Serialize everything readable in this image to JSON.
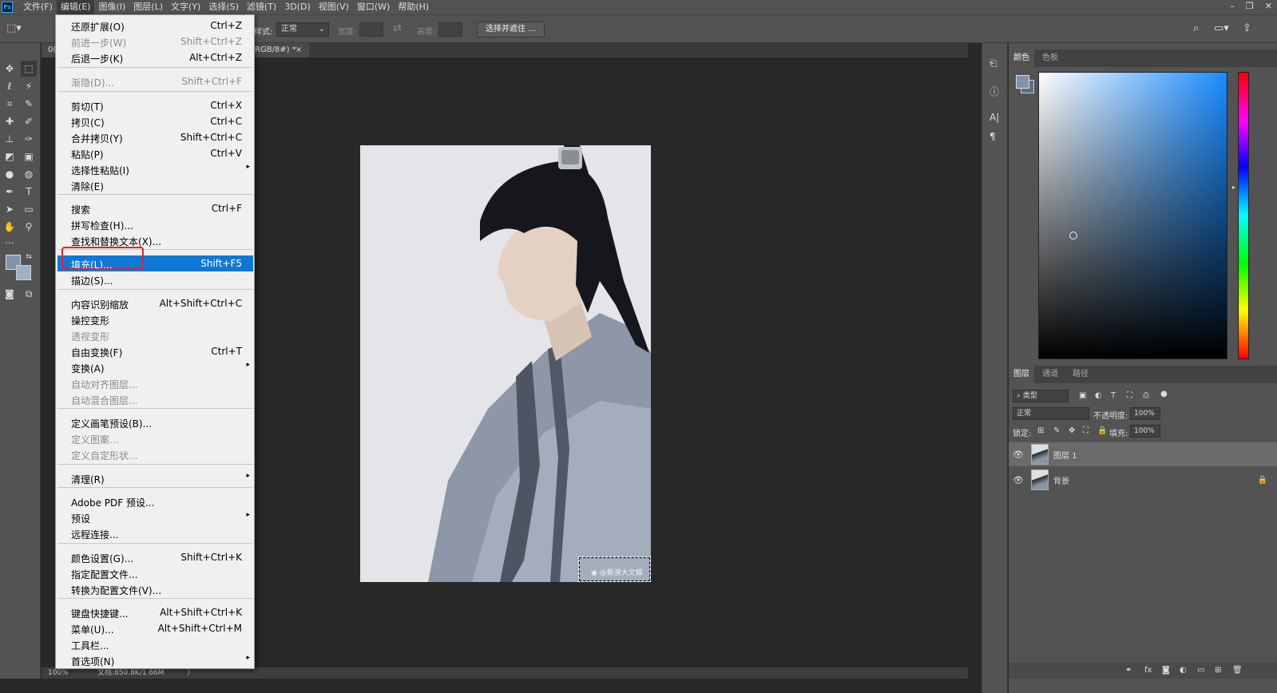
{
  "menubar": {
    "logo": "Ps",
    "items": [
      "文件(F)",
      "编辑(E)",
      "图像(I)",
      "图层(L)",
      "文字(Y)",
      "选择(S)",
      "滤镜(T)",
      "3D(D)",
      "视图(V)",
      "窗口(W)",
      "帮助(H)"
    ],
    "window_controls": [
      "–",
      "❐",
      "✕"
    ]
  },
  "options": {
    "style_label": "样式:",
    "style_value": "正常",
    "width_label": "宽度:",
    "height_label": "高度:",
    "select_mask_button": "选择并遮住 ..."
  },
  "document": {
    "tab_title": "RGB/8#) *",
    "tab_prefix": "0(",
    "watermark": "@新浪大文娱"
  },
  "status": {
    "zoom": "100%",
    "doc_info": "文档:850.8K/1.66M",
    "arrow": "〉"
  },
  "edit_menu": [
    {
      "label": "还原扩展(O)",
      "shortcut": "Ctrl+Z",
      "disabled": false
    },
    {
      "label": "前进一步(W)",
      "shortcut": "Shift+Ctrl+Z",
      "disabled": true
    },
    {
      "label": "后退一步(K)",
      "shortcut": "Alt+Ctrl+Z",
      "disabled": false
    },
    {
      "label": "渐隐(D)...",
      "shortcut": "Shift+Ctrl+F",
      "disabled": true
    },
    {
      "label": "剪切(T)",
      "shortcut": "Ctrl+X",
      "disabled": false
    },
    {
      "label": "拷贝(C)",
      "shortcut": "Ctrl+C",
      "disabled": false
    },
    {
      "label": "合并拷贝(Y)",
      "shortcut": "Shift+Ctrl+C",
      "disabled": false
    },
    {
      "label": "粘贴(P)",
      "shortcut": "Ctrl+V",
      "disabled": false
    },
    {
      "label": "选择性粘贴(I)",
      "shortcut": "",
      "disabled": false,
      "submenu": true
    },
    {
      "label": "清除(E)",
      "shortcut": "",
      "disabled": false
    },
    {
      "label": "搜索",
      "shortcut": "Ctrl+F",
      "disabled": false
    },
    {
      "label": "拼写检查(H)...",
      "shortcut": "",
      "disabled": false
    },
    {
      "label": "查找和替换文本(X)...",
      "shortcut": "",
      "disabled": false
    },
    {
      "label": "填充(L)...",
      "shortcut": "Shift+F5",
      "disabled": false,
      "highlighted": true
    },
    {
      "label": "描边(S)...",
      "shortcut": "",
      "disabled": false
    },
    {
      "label": "内容识别缩放",
      "shortcut": "Alt+Shift+Ctrl+C",
      "disabled": false
    },
    {
      "label": "操控变形",
      "shortcut": "",
      "disabled": false
    },
    {
      "label": "透视变形",
      "shortcut": "",
      "disabled": true
    },
    {
      "label": "自由变换(F)",
      "shortcut": "Ctrl+T",
      "disabled": false
    },
    {
      "label": "变换(A)",
      "shortcut": "",
      "disabled": false,
      "submenu": true
    },
    {
      "label": "自动对齐图层...",
      "shortcut": "",
      "disabled": true
    },
    {
      "label": "自动混合图层...",
      "shortcut": "",
      "disabled": true
    },
    {
      "label": "定义画笔预设(B)...",
      "shortcut": "",
      "disabled": false
    },
    {
      "label": "定义图案...",
      "shortcut": "",
      "disabled": true
    },
    {
      "label": "定义自定形状...",
      "shortcut": "",
      "disabled": true
    },
    {
      "label": "清理(R)",
      "shortcut": "",
      "disabled": false,
      "submenu": true
    },
    {
      "label": "Adobe PDF 预设...",
      "shortcut": "",
      "disabled": false
    },
    {
      "label": "预设",
      "shortcut": "",
      "disabled": false,
      "submenu": true
    },
    {
      "label": "远程连接...",
      "shortcut": "",
      "disabled": false
    },
    {
      "label": "颜色设置(G)...",
      "shortcut": "Shift+Ctrl+K",
      "disabled": false
    },
    {
      "label": "指定配置文件...",
      "shortcut": "",
      "disabled": false
    },
    {
      "label": "转换为配置文件(V)...",
      "shortcut": "",
      "disabled": false
    },
    {
      "label": "键盘快捷键...",
      "shortcut": "Alt+Shift+Ctrl+K",
      "disabled": false
    },
    {
      "label": "菜单(U)...",
      "shortcut": "Alt+Shift+Ctrl+M",
      "disabled": false
    },
    {
      "label": "工具栏...",
      "shortcut": "",
      "disabled": false
    },
    {
      "label": "首选项(N)",
      "shortcut": "",
      "disabled": false,
      "submenu": true
    }
  ],
  "color_panel": {
    "tabs": [
      "颜色",
      "色板"
    ],
    "fg_color": "#7f93a9",
    "hue_accent": "#1a8cff"
  },
  "layers_panel": {
    "tabs": [
      "图层",
      "通道",
      "路径"
    ],
    "filter_label": "类型",
    "blend_mode": "正常",
    "opacity_label": "不透明度:",
    "opacity_value": "100%",
    "lock_label": "锁定:",
    "fill_label": "填充:",
    "fill_value": "100%",
    "layers": [
      {
        "name": "图层 1",
        "selected": true,
        "locked": false
      },
      {
        "name": "背景",
        "selected": false,
        "locked": true
      }
    ],
    "footer_icons": [
      "link-icon",
      "fx-icon",
      "mask-icon",
      "adjustment-icon",
      "group-icon",
      "new-layer-icon",
      "trash-icon"
    ]
  },
  "accent": {
    "highlight": "#0f78d7",
    "annotation_red": "#e3242b"
  }
}
